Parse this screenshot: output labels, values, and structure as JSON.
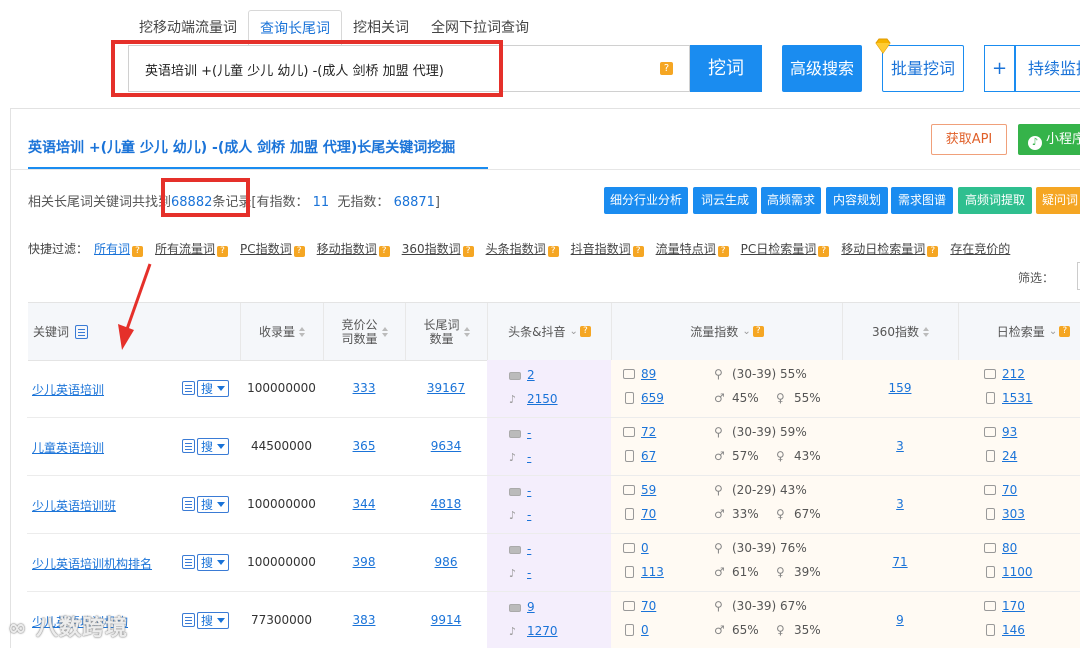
{
  "tabs": [
    {
      "label": "挖移动端流量词",
      "active": false
    },
    {
      "label": "查询长尾词",
      "active": true
    },
    {
      "label": "挖相关词",
      "active": false
    },
    {
      "label": "全网下拉词查询",
      "active": false
    }
  ],
  "search": {
    "value": "英语培训 +(儿童 少儿 幼儿) -(成人 剑桥 加盟 代理)",
    "help_icon": "?",
    "dig_label": "挖词",
    "advanced_label": "高级搜索",
    "batch_label": "批量挖词",
    "plus_label": "+",
    "monitor_label": "持续监控"
  },
  "panel": {
    "title": "英语培训 +(儿童 少儿 幼儿) -(成人 剑桥 加盟 代理)长尾关键词挖掘",
    "api_label": "获取API",
    "mini_label": "小程序"
  },
  "stats": {
    "prefix": "相关长尾词关键词共找到",
    "total": "68882",
    "mid": "条记录[有指数：",
    "with_index": "11",
    "mid2": "无指数：",
    "without_index": "68871",
    "suffix": "]"
  },
  "feature_buttons": [
    {
      "label": "细分行业分析",
      "color": "#1a8cf0"
    },
    {
      "label": "词云生成",
      "color": "#1a8cf0"
    },
    {
      "label": "高频需求",
      "color": "#1a8cf0"
    },
    {
      "label": "内容规划",
      "color": "#1a8cf0"
    },
    {
      "label": "需求图谱",
      "color": "#1a8cf0"
    },
    {
      "label": "高频词提取",
      "color": "#2fbf8f"
    },
    {
      "label": "疑问词",
      "color": "#f5a623"
    }
  ],
  "filters": {
    "label": "快捷过滤：",
    "items": [
      "所有词",
      "所有流量词",
      "PC指数词",
      "移动指数词",
      "360指数词",
      "头条指数词",
      "抖音指数词",
      "流量特点词",
      "PC日检索量词",
      "移动日检索量词",
      "存在竞价的"
    ]
  },
  "sift_label": "筛选：",
  "columns": {
    "keyword": "关键词",
    "included": "收录量",
    "bid_l1": "竞价公",
    "bid_l2": "司数量",
    "tail_l1": "长尾词",
    "tail_l2": "数量",
    "toutiao": "头条&抖音",
    "flow": "流量指数",
    "idx360": "360指数",
    "daily": "日检索量"
  },
  "search_btn_label": "搜",
  "rows": [
    {
      "keyword": "少儿英语培训",
      "included": "100000000",
      "bid": "333",
      "tail": "39167",
      "toutiao": "2",
      "douyin": "2150",
      "pc_flow": "89",
      "mobile_flow": "659",
      "age": "(30-39) 55%",
      "male": "45%",
      "female": "55%",
      "idx360": "159",
      "pc_daily": "212",
      "mobile_daily": "1531"
    },
    {
      "keyword": "儿童英语培训",
      "included": "44500000",
      "bid": "365",
      "tail": "9634",
      "toutiao": "-",
      "douyin": "-",
      "pc_flow": "72",
      "mobile_flow": "67",
      "age": "(30-39) 59%",
      "male": "57%",
      "female": "43%",
      "idx360": "3",
      "pc_daily": "93",
      "mobile_daily": "24"
    },
    {
      "keyword": "少儿英语培训班",
      "included": "100000000",
      "bid": "344",
      "tail": "4818",
      "toutiao": "-",
      "douyin": "-",
      "pc_flow": "59",
      "mobile_flow": "70",
      "age": "(20-29) 43%",
      "male": "33%",
      "female": "67%",
      "idx360": "3",
      "pc_daily": "70",
      "mobile_daily": "303"
    },
    {
      "keyword": "少儿英语培训机构排名",
      "included": "100000000",
      "bid": "398",
      "tail": "986",
      "toutiao": "-",
      "douyin": "-",
      "pc_flow": "0",
      "mobile_flow": "113",
      "age": "(30-39) 76%",
      "male": "61%",
      "female": "39%",
      "idx360": "71",
      "pc_daily": "80",
      "mobile_daily": "1100"
    },
    {
      "keyword": "少儿英语培训机构",
      "included": "77300000",
      "bid": "383",
      "tail": "9914",
      "toutiao": "9",
      "douyin": "1270",
      "pc_flow": "70",
      "mobile_flow": "0",
      "age": "(30-39) 67%",
      "male": "65%",
      "female": "35%",
      "idx360": "9",
      "pc_daily": "170",
      "mobile_daily": "146"
    }
  ],
  "watermark": "八数跨境",
  "colors": {
    "accent": "#1a8cf0",
    "highlight": "#e5302a"
  }
}
